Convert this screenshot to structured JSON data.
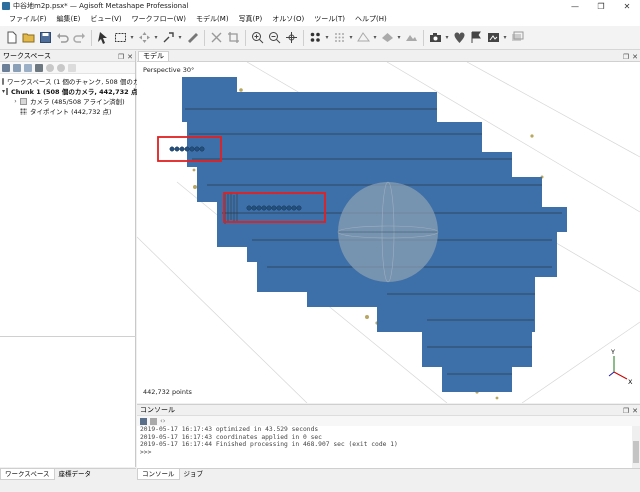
{
  "window": {
    "title": "中谷地m2p.psx* — Agisoft Metashape Professional",
    "controls": [
      "—",
      "❐",
      "✕"
    ]
  },
  "menu": [
    "ファイル(F)",
    "編集(E)",
    "ビュー(V)",
    "ワークフロー(W)",
    "モデル(M)",
    "写真(P)",
    "オルソ(O)",
    "ツール(T)",
    "ヘルプ(H)"
  ],
  "workspace": {
    "title": "ワークスペース",
    "items": [
      {
        "label": "ワークスペース (1 個のチャンク, 508 個のカメラ)"
      },
      {
        "label": "Chunk 1 (508 個のカメラ, 442,732 点) [R]"
      },
      {
        "label": "カメラ (485/508 アライン済創)"
      },
      {
        "label": "タイポイント (442,732 点)"
      }
    ],
    "tabs": [
      "ワークスペース",
      "座標データ"
    ]
  },
  "model": {
    "tab": "モデル",
    "perspective": "Perspective 30°",
    "points": "442,732 points",
    "axes": {
      "y": "Y",
      "x": "X"
    }
  },
  "console": {
    "title": "コンソール",
    "lines": [
      "2019-05-17 16:17:43 optimized in 43.529 seconds",
      "2019-05-17 16:17:43 coordinates applied in 0 sec",
      "2019-05-17 16:17:44 Finished processing in 468.907 sec (exit code 1)",
      ">>>"
    ],
    "tabs": [
      "コンソール",
      "ジョブ"
    ]
  },
  "colors": {
    "cloud_blue": "#3d6fa8",
    "highlight_red": "#e02020",
    "sphere": "#8fa2b4"
  }
}
